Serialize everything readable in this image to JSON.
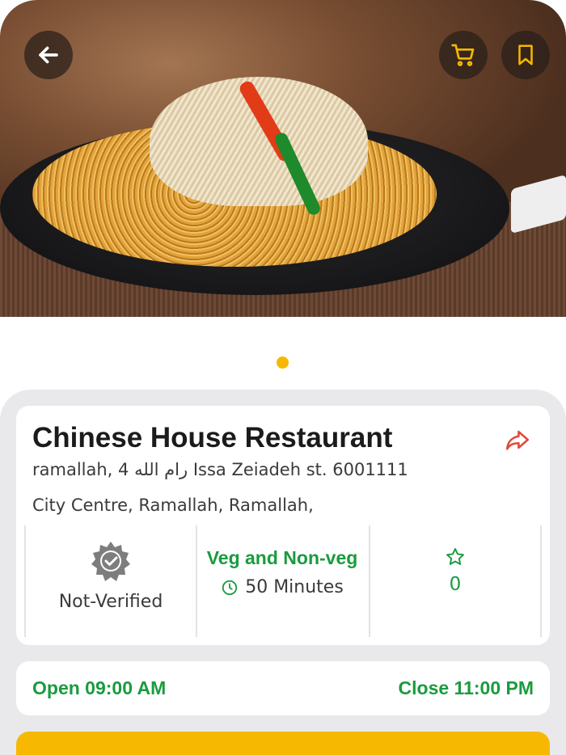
{
  "hero": {
    "image_alt": "Plate of chow mein noodles",
    "carousel_active_index": 0,
    "carousel_count": 1
  },
  "header_actions": {
    "back_icon": "arrow-left-icon",
    "cart_icon": "shopping-cart-icon",
    "bookmark_icon": "bookmark-icon"
  },
  "restaurant": {
    "name": "Chinese House Restaurant",
    "address_line1": "ramallah, 4 رام الله Issa Zeiadeh st. 6001111",
    "address_line2": "City Centre, Ramallah, Ramallah,",
    "share_icon": "share-icon"
  },
  "stats": {
    "verification": "Not-Verified",
    "verification_icon": "verified-badge-icon",
    "diet_type": "Veg and Non-veg",
    "delivery_time": "50 Minutes",
    "rating": "0",
    "rating_icon": "star-outline-icon"
  },
  "hours": {
    "open": "Open 09:00 AM",
    "close": "Close 11:00 PM"
  },
  "colors": {
    "accent": "#f6b800",
    "green": "#1a9b3f",
    "share": "#e04a3a",
    "panel_bg": "#e9e9ec",
    "icon_btn_bg": "#2e231d"
  }
}
